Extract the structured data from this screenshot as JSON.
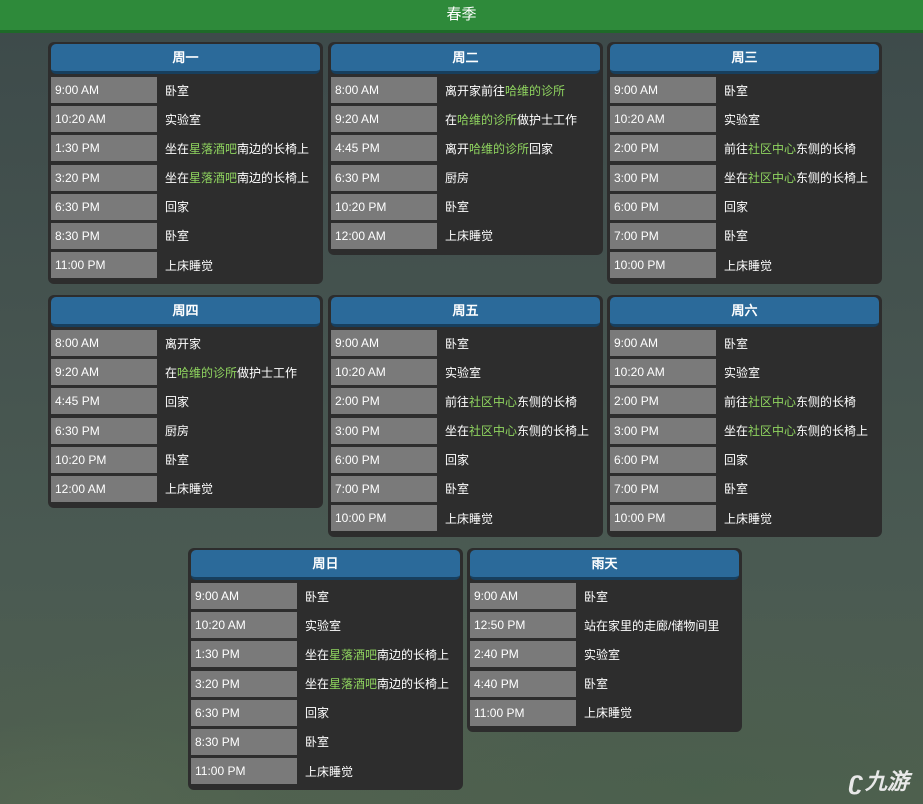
{
  "title": "春季",
  "watermark": "九游",
  "highlight_color": "#8fd45f",
  "cards": [
    {
      "day": "周一",
      "rows": [
        {
          "time": "9:00 AM",
          "pre": "卧室",
          "hl": "",
          "post": ""
        },
        {
          "time": "10:20 AM",
          "pre": "实验室",
          "hl": "",
          "post": ""
        },
        {
          "time": "1:30 PM",
          "pre": "坐在",
          "hl": "星落酒吧",
          "post": "南边的长椅上"
        },
        {
          "time": "3:20 PM",
          "pre": "坐在",
          "hl": "星落酒吧",
          "post": "南边的长椅上"
        },
        {
          "time": "6:30 PM",
          "pre": "回家",
          "hl": "",
          "post": ""
        },
        {
          "time": "8:30 PM",
          "pre": "卧室",
          "hl": "",
          "post": ""
        },
        {
          "time": "11:00 PM",
          "pre": "上床睡觉",
          "hl": "",
          "post": ""
        }
      ]
    },
    {
      "day": "周二",
      "rows": [
        {
          "time": "8:00 AM",
          "pre": "离开家前往",
          "hl": "哈维的诊所",
          "post": ""
        },
        {
          "time": "9:20 AM",
          "pre": "在",
          "hl": "哈维的诊所",
          "post": "做护士工作"
        },
        {
          "time": "4:45 PM",
          "pre": "离开",
          "hl": "哈维的诊所",
          "post": "回家"
        },
        {
          "time": "6:30 PM",
          "pre": "厨房",
          "hl": "",
          "post": ""
        },
        {
          "time": "10:20 PM",
          "pre": "卧室",
          "hl": "",
          "post": ""
        },
        {
          "time": "12:00 AM",
          "pre": "上床睡觉",
          "hl": "",
          "post": ""
        }
      ]
    },
    {
      "day": "周三",
      "rows": [
        {
          "time": "9:00 AM",
          "pre": "卧室",
          "hl": "",
          "post": ""
        },
        {
          "time": "10:20 AM",
          "pre": "实验室",
          "hl": "",
          "post": ""
        },
        {
          "time": "2:00 PM",
          "pre": "前往",
          "hl": "社区中心",
          "post": "东侧的长椅"
        },
        {
          "time": "3:00 PM",
          "pre": "坐在",
          "hl": "社区中心",
          "post": "东侧的长椅上"
        },
        {
          "time": "6:00 PM",
          "pre": "回家",
          "hl": "",
          "post": ""
        },
        {
          "time": "7:00 PM",
          "pre": "卧室",
          "hl": "",
          "post": ""
        },
        {
          "time": "10:00 PM",
          "pre": "上床睡觉",
          "hl": "",
          "post": ""
        }
      ]
    },
    {
      "day": "周四",
      "rows": [
        {
          "time": "8:00 AM",
          "pre": "离开家",
          "hl": "",
          "post": ""
        },
        {
          "time": "9:20 AM",
          "pre": "在",
          "hl": "哈维的诊所",
          "post": "做护士工作"
        },
        {
          "time": "4:45 PM",
          "pre": "回家",
          "hl": "",
          "post": ""
        },
        {
          "time": "6:30 PM",
          "pre": "厨房",
          "hl": "",
          "post": ""
        },
        {
          "time": "10:20 PM",
          "pre": "卧室",
          "hl": "",
          "post": ""
        },
        {
          "time": "12:00 AM",
          "pre": "上床睡觉",
          "hl": "",
          "post": ""
        }
      ]
    },
    {
      "day": "周五",
      "rows": [
        {
          "time": "9:00 AM",
          "pre": "卧室",
          "hl": "",
          "post": ""
        },
        {
          "time": "10:20 AM",
          "pre": "实验室",
          "hl": "",
          "post": ""
        },
        {
          "time": "2:00 PM",
          "pre": "前往",
          "hl": "社区中心",
          "post": "东侧的长椅"
        },
        {
          "time": "3:00 PM",
          "pre": "坐在",
          "hl": "社区中心",
          "post": "东侧的长椅上"
        },
        {
          "time": "6:00 PM",
          "pre": "回家",
          "hl": "",
          "post": ""
        },
        {
          "time": "7:00 PM",
          "pre": "卧室",
          "hl": "",
          "post": ""
        },
        {
          "time": "10:00 PM",
          "pre": "上床睡觉",
          "hl": "",
          "post": ""
        }
      ]
    },
    {
      "day": "周六",
      "rows": [
        {
          "time": "9:00 AM",
          "pre": "卧室",
          "hl": "",
          "post": ""
        },
        {
          "time": "10:20 AM",
          "pre": "实验室",
          "hl": "",
          "post": ""
        },
        {
          "time": "2:00 PM",
          "pre": "前往",
          "hl": "社区中心",
          "post": "东侧的长椅"
        },
        {
          "time": "3:00 PM",
          "pre": "坐在",
          "hl": "社区中心",
          "post": "东侧的长椅上"
        },
        {
          "time": "6:00 PM",
          "pre": "回家",
          "hl": "",
          "post": ""
        },
        {
          "time": "7:00 PM",
          "pre": "卧室",
          "hl": "",
          "post": ""
        },
        {
          "time": "10:00 PM",
          "pre": "上床睡觉",
          "hl": "",
          "post": ""
        }
      ]
    },
    {
      "day": "周日",
      "rows": [
        {
          "time": "9:00 AM",
          "pre": "卧室",
          "hl": "",
          "post": ""
        },
        {
          "time": "10:20 AM",
          "pre": "实验室",
          "hl": "",
          "post": ""
        },
        {
          "time": "1:30 PM",
          "pre": "坐在",
          "hl": "星落酒吧",
          "post": "南边的长椅上"
        },
        {
          "time": "3:20 PM",
          "pre": "坐在",
          "hl": "星落酒吧",
          "post": "南边的长椅上"
        },
        {
          "time": "6:30 PM",
          "pre": "回家",
          "hl": "",
          "post": ""
        },
        {
          "time": "8:30 PM",
          "pre": "卧室",
          "hl": "",
          "post": ""
        },
        {
          "time": "11:00 PM",
          "pre": "上床睡觉",
          "hl": "",
          "post": ""
        }
      ]
    },
    {
      "day": "雨天",
      "rows": [
        {
          "time": "9:00 AM",
          "pre": "卧室",
          "hl": "",
          "post": ""
        },
        {
          "time": "12:50 PM",
          "pre": "站在家里的走廊/储物间里",
          "hl": "",
          "post": ""
        },
        {
          "time": "2:40 PM",
          "pre": "实验室",
          "hl": "",
          "post": ""
        },
        {
          "time": "4:40 PM",
          "pre": "卧室",
          "hl": "",
          "post": ""
        },
        {
          "time": "11:00 PM",
          "pre": "上床睡觉",
          "hl": "",
          "post": ""
        }
      ]
    }
  ]
}
